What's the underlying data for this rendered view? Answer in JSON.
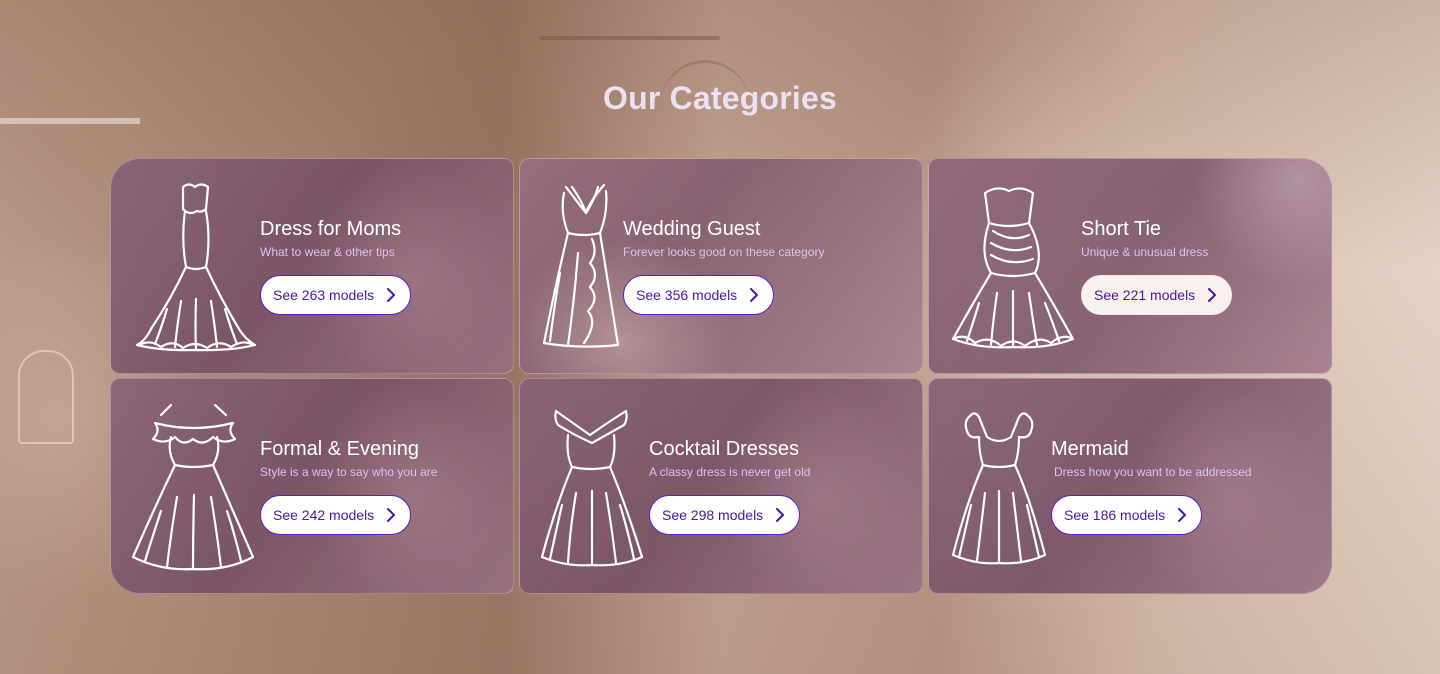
{
  "section": {
    "title": "Our Categories"
  },
  "categories": [
    {
      "title": "Dress for Moms",
      "subtitle": "What to wear & other tips",
      "button_label": "See 263 models",
      "icon": "mermaid-gown-icon"
    },
    {
      "title": "Wedding Guest",
      "subtitle": "Forever looks good on these category",
      "button_label": "See 356 models",
      "icon": "halter-maxi-dress-icon"
    },
    {
      "title": "Short Tie",
      "subtitle": "Unique & unusual dress",
      "button_label": "See 221 models",
      "icon": "strapless-short-dress-icon"
    },
    {
      "title": "Formal & Evening",
      "subtitle": "Style is a way to say who you are",
      "button_label": "See 242 models",
      "icon": "off-shoulder-ruffle-dress-icon"
    },
    {
      "title": "Cocktail Dresses",
      "subtitle": "A classy dress is never get old",
      "button_label": "See 298 models",
      "icon": "off-shoulder-cocktail-dress-icon"
    },
    {
      "title": "Mermaid",
      "subtitle": "Dress how you want to be addressed",
      "button_label": "See 186 models",
      "icon": "cap-sleeve-dress-icon"
    }
  ],
  "colors": {
    "button_border": "#5b1fc4",
    "button_text": "#4a16a8",
    "heading": "#ece0f5",
    "subtitle": "#dcc3f0"
  }
}
